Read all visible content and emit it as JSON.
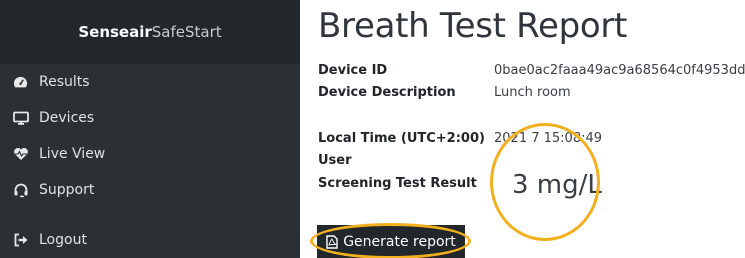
{
  "sidebar": {
    "brand_bold": "Senseair",
    "brand_rest": "SafeStart",
    "items": [
      {
        "label": "Results",
        "icon": "dashboard-icon"
      },
      {
        "label": "Devices",
        "icon": "monitor-icon"
      },
      {
        "label": "Live View",
        "icon": "heartbeat-icon"
      },
      {
        "label": "Support",
        "icon": "headset-icon"
      },
      {
        "label": "Logout",
        "icon": "logout-icon"
      }
    ]
  },
  "report": {
    "title": "Breath Test Report",
    "fields": [
      {
        "label": "Device ID",
        "value": "0bae0ac2faaa49ac9a68564c0f4953dd"
      },
      {
        "label": "Device Description",
        "value": "Lunch room"
      },
      {
        "label": "Local Time (UTC+2:00)",
        "value": "2021   7 15:08:49"
      },
      {
        "label": "User",
        "value": ""
      },
      {
        "label": "Screening Test Result",
        "value": ""
      }
    ],
    "result_value": "3 mg/L",
    "generate_button": "Generate report"
  },
  "colors": {
    "sidebar_bg": "#2b3034",
    "brand_bg": "#22272b",
    "highlight": "#f2b01e"
  }
}
